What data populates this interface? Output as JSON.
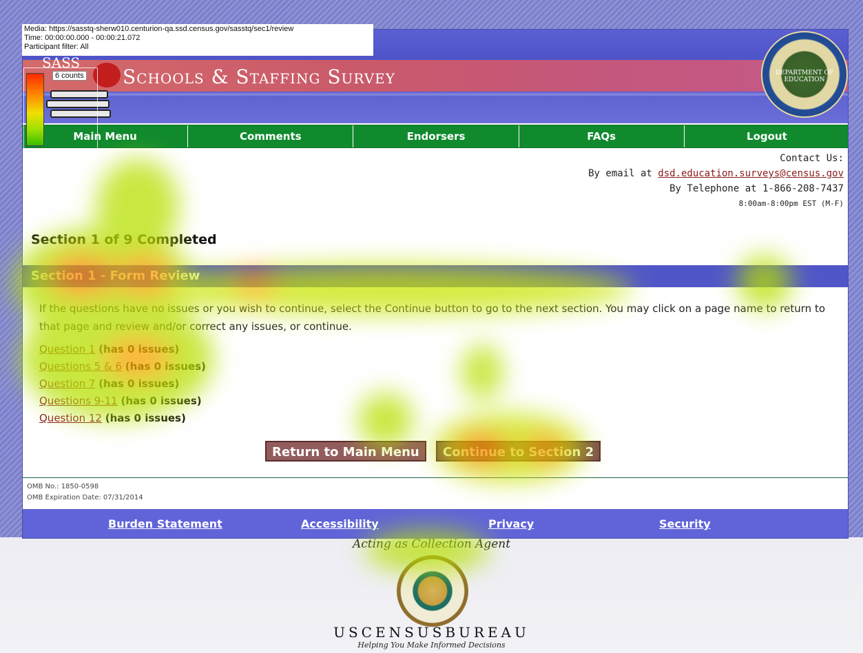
{
  "overlay": {
    "media_line": "Media: https://sasstq-sherw010.centurion-qa.ssd.census.gov/sasstq/sec1/review",
    "time_line": "Time: 00:00:00.000 - 00:00:21.072",
    "filter_line": "Participant filter: All",
    "legend_label": "6 counts"
  },
  "header": {
    "logo_word": "SASS",
    "title": "Schools & Staffing Survey",
    "seal_text": "DEPARTMENT OF EDUCATION"
  },
  "nav": [
    {
      "label": "Main Menu"
    },
    {
      "label": "Comments"
    },
    {
      "label": "Endorsers"
    },
    {
      "label": "FAQs"
    },
    {
      "label": "Logout"
    }
  ],
  "contact": {
    "heading": "Contact Us:",
    "email_prefix": "By email at ",
    "email": "dsd.education.surveys@census.gov",
    "phone": "By Telephone at 1-866-208-7437",
    "hours": "8:00am-8:00pm EST (M-F)"
  },
  "main": {
    "status": "Section 1 of 9 Completed",
    "section_title": "Section 1 - Form Review",
    "instructions": "If the questions have no issues or you wish to continue, select the Continue button to go to the next section. You may click on a page name to return to that page and review and/or correct any issues, or continue.",
    "questions": [
      {
        "label": "Question 1",
        "status": "(has 0 issues)"
      },
      {
        "label": "Questions 5 & 6",
        "status": "(has 0 issues)"
      },
      {
        "label": "Question 7",
        "status": "(has 0 issues)"
      },
      {
        "label": "Questions 9-11",
        "status": "(has 0 issues)"
      },
      {
        "label": "Question 12",
        "status": "(has 0 issues)"
      }
    ],
    "return_button": "Return to Main Menu",
    "continue_button": "Continue to Section 2"
  },
  "omb": {
    "number": "OMB No.: 1850-0598",
    "expiration": "OMB Expiration Date: 07/31/2014"
  },
  "footer": {
    "links": [
      {
        "label": "Burden Statement"
      },
      {
        "label": "Accessibility"
      },
      {
        "label": "Privacy"
      },
      {
        "label": "Security"
      }
    ],
    "agent": "Acting as Collection Agent",
    "census_name": "USCENSUSBUREAU",
    "census_tagline": "Helping You Make Informed Decisions"
  }
}
